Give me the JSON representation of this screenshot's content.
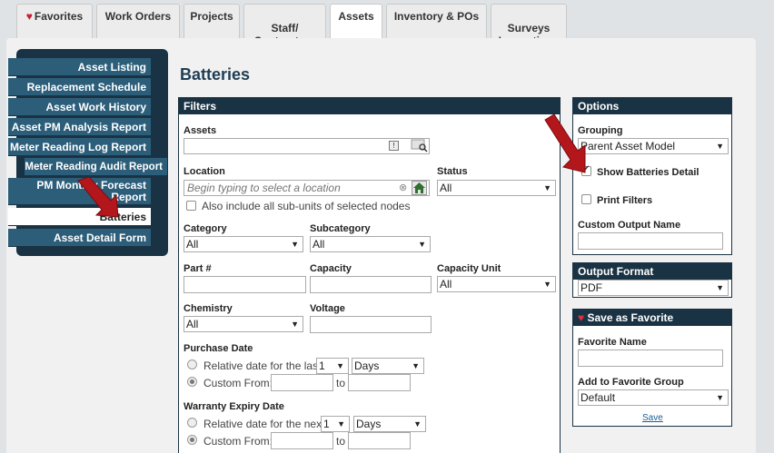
{
  "tabs": [
    {
      "label": "Favorites",
      "active": false
    },
    {
      "label": "Work Orders",
      "active": false
    },
    {
      "label": "Projects",
      "active": false
    },
    {
      "label": "Staff/\nContractors",
      "active": false
    },
    {
      "label": "Assets",
      "active": true
    },
    {
      "label": "Inventory & POs",
      "active": false
    },
    {
      "label": "Surveys\nInspections",
      "active": false
    }
  ],
  "sidebar": {
    "items": [
      {
        "label": "Asset Listing"
      },
      {
        "label": "Replacement Schedule"
      },
      {
        "label": "Asset Work History"
      },
      {
        "label": "Asset PM Analysis Report"
      },
      {
        "label": "Meter Reading Log Report"
      },
      {
        "label": "Meter Reading Audit Report"
      },
      {
        "label": "PM Monthly Forecast Report"
      },
      {
        "label": "Batteries",
        "active": true
      },
      {
        "label": "Asset Detail Form"
      }
    ]
  },
  "page_title": "Batteries",
  "filters": {
    "heading": "Filters",
    "assets_label": "Assets",
    "location_label": "Location",
    "location_placeholder": "Begin typing to select a location",
    "include_subunits_label": "Also include all sub-units of selected nodes",
    "status_label": "Status",
    "status_value": "All",
    "category_label": "Category",
    "category_value": "All",
    "subcategory_label": "Subcategory",
    "subcategory_value": "All",
    "part_label": "Part #",
    "capacity_label": "Capacity",
    "capacity_unit_label": "Capacity Unit",
    "capacity_unit_value": "All",
    "chemistry_label": "Chemistry",
    "chemistry_value": "All",
    "voltage_label": "Voltage",
    "purchase_date_label": "Purchase Date",
    "purchase_relative_label": "Relative date for the last",
    "purchase_relative_num": "1",
    "purchase_relative_unit": "Days",
    "purchase_custom_label": "Custom From:",
    "purchase_to_label": "to",
    "warranty_label": "Warranty Expiry Date",
    "warranty_relative_label": "Relative date for the next",
    "warranty_relative_num": "1",
    "warranty_relative_unit": "Days",
    "warranty_custom_label": "Custom From:",
    "warranty_to_label": "to"
  },
  "options": {
    "heading": "Options",
    "grouping_label": "Grouping",
    "grouping_value": "Parent Asset Model",
    "show_detail_label": "Show Batteries Detail",
    "print_filters_label": "Print Filters",
    "custom_output_label": "Custom Output Name"
  },
  "output": {
    "heading": "Output Format",
    "value": "PDF"
  },
  "favorite": {
    "heading": "Save as Favorite",
    "name_label": "Favorite Name",
    "group_label": "Add to Favorite Group",
    "group_value": "Default",
    "save_label": "Save"
  },
  "colors": {
    "nav_bg": "#1a3344",
    "nav_item": "#2c5e7a",
    "heart": "#c8202a",
    "pointer_arrow": "#b3171c"
  },
  "icons": {
    "heart": "heart-icon",
    "asset_browse": "info-icon",
    "asset_search": "magnifier-icon",
    "clear": "clear-icon",
    "home": "home-icon",
    "pointer": "red-arrow-icon"
  }
}
